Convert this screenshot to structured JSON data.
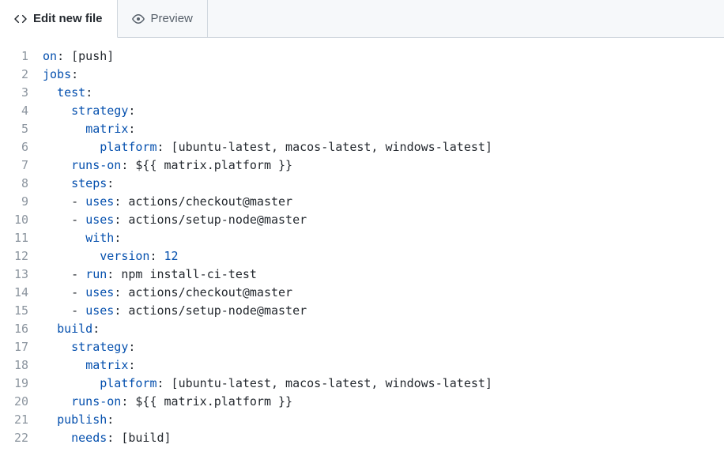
{
  "tabs": {
    "edit": "Edit new file",
    "preview": "Preview"
  },
  "code": {
    "lines": [
      [
        [
          "k",
          "on"
        ],
        [
          "v",
          ": [push]"
        ]
      ],
      [
        [
          "k",
          "jobs"
        ],
        [
          "v",
          ":"
        ]
      ],
      [
        [
          "v",
          "  "
        ],
        [
          "k",
          "test"
        ],
        [
          "v",
          ":"
        ]
      ],
      [
        [
          "v",
          "    "
        ],
        [
          "k",
          "strategy"
        ],
        [
          "v",
          ":"
        ]
      ],
      [
        [
          "v",
          "      "
        ],
        [
          "k",
          "matrix"
        ],
        [
          "v",
          ":"
        ]
      ],
      [
        [
          "v",
          "        "
        ],
        [
          "k",
          "platform"
        ],
        [
          "v",
          ": [ubuntu-latest, macos-latest, windows-latest]"
        ]
      ],
      [
        [
          "v",
          "    "
        ],
        [
          "k",
          "runs-on"
        ],
        [
          "v",
          ": ${{ matrix.platform }}"
        ]
      ],
      [
        [
          "v",
          "    "
        ],
        [
          "k",
          "steps"
        ],
        [
          "v",
          ":"
        ]
      ],
      [
        [
          "v",
          "    "
        ],
        [
          "d",
          "- "
        ],
        [
          "k",
          "uses"
        ],
        [
          "v",
          ": actions/checkout@master"
        ]
      ],
      [
        [
          "v",
          "    "
        ],
        [
          "d",
          "- "
        ],
        [
          "k",
          "uses"
        ],
        [
          "v",
          ": actions/setup-node@master"
        ]
      ],
      [
        [
          "v",
          "      "
        ],
        [
          "k",
          "with"
        ],
        [
          "v",
          ":"
        ]
      ],
      [
        [
          "v",
          "        "
        ],
        [
          "k",
          "version"
        ],
        [
          "v",
          ": "
        ],
        [
          "n",
          "12"
        ]
      ],
      [
        [
          "v",
          "    "
        ],
        [
          "d",
          "- "
        ],
        [
          "k",
          "run"
        ],
        [
          "v",
          ": npm install-ci-test"
        ]
      ],
      [
        [
          "v",
          "    "
        ],
        [
          "d",
          "- "
        ],
        [
          "k",
          "uses"
        ],
        [
          "v",
          ": actions/checkout@master"
        ]
      ],
      [
        [
          "v",
          "    "
        ],
        [
          "d",
          "- "
        ],
        [
          "k",
          "uses"
        ],
        [
          "v",
          ": actions/setup-node@master"
        ]
      ],
      [
        [
          "v",
          "  "
        ],
        [
          "k",
          "build"
        ],
        [
          "v",
          ":"
        ]
      ],
      [
        [
          "v",
          "    "
        ],
        [
          "k",
          "strategy"
        ],
        [
          "v",
          ":"
        ]
      ],
      [
        [
          "v",
          "      "
        ],
        [
          "k",
          "matrix"
        ],
        [
          "v",
          ":"
        ]
      ],
      [
        [
          "v",
          "        "
        ],
        [
          "k",
          "platform"
        ],
        [
          "v",
          ": [ubuntu-latest, macos-latest, windows-latest]"
        ]
      ],
      [
        [
          "v",
          "    "
        ],
        [
          "k",
          "runs-on"
        ],
        [
          "v",
          ": ${{ matrix.platform }}"
        ]
      ],
      [
        [
          "v",
          "  "
        ],
        [
          "k",
          "publish"
        ],
        [
          "v",
          ":"
        ]
      ],
      [
        [
          "v",
          "    "
        ],
        [
          "k",
          "needs"
        ],
        [
          "v",
          ": [build]"
        ]
      ]
    ]
  }
}
